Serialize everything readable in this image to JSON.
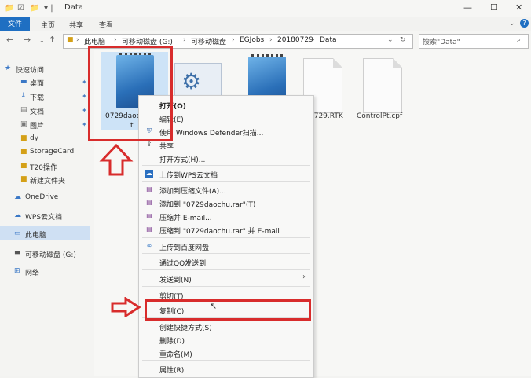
{
  "window": {
    "title": "Data",
    "quick_access": "▾ | ",
    "minimize": "—",
    "maximize": "☐",
    "close": "✕",
    "help": "?"
  },
  "ribbon": {
    "tabs": [
      "文件",
      "主页",
      "共享",
      "查看"
    ]
  },
  "address": {
    "crumbs": [
      "此电脑",
      "可移动磁盘 (G:)",
      "可移动磁盘",
      "EGJobs",
      "20180729",
      "Data"
    ],
    "search_placeholder": "搜索\"Data\""
  },
  "navpane": {
    "items": [
      {
        "label": "快速访问"
      },
      {
        "label": "桌面"
      },
      {
        "label": "下载"
      },
      {
        "label": "文档"
      },
      {
        "label": "图片"
      },
      {
        "label": "dy"
      },
      {
        "label": "StorageCard"
      },
      {
        "label": "T20操作"
      },
      {
        "label": "新建文件夹"
      },
      {
        "label": "OneDrive"
      },
      {
        "label": "WPS云文档"
      },
      {
        "label": "此电脑"
      },
      {
        "label": "可移动磁盘 (G:)"
      },
      {
        "label": "网络"
      }
    ]
  },
  "files": [
    {
      "name_line1": "0729daoc",
      "name_line2": "t",
      "icon": "notebook-icon"
    },
    {
      "name": "",
      "icon": "settings-file-icon"
    },
    {
      "name": "",
      "icon": "notebook-icon"
    },
    {
      "name": "0729.RTK",
      "icon": "document-icon"
    },
    {
      "name": "ControlPt.cpf",
      "icon": "document-icon"
    }
  ],
  "context_menu": {
    "items": [
      {
        "label": "打开(O)",
        "bold": true
      },
      {
        "label": "编辑(E)"
      },
      {
        "label": "使用 Windows Defender扫描..."
      },
      {
        "label": "共享"
      },
      {
        "label": "打开方式(H)..."
      },
      {
        "label": "上传到WPS云文档"
      },
      {
        "label": "添加到压缩文件(A)..."
      },
      {
        "label": "添加到 \"0729daochu.rar\"(T)"
      },
      {
        "label": "压缩并 E-mail..."
      },
      {
        "label": "压缩到 \"0729daochu.rar\" 并 E-mail"
      },
      {
        "label": "上传到百度网盘"
      },
      {
        "label": "通过QQ发送到"
      },
      {
        "label": "发送到(N)"
      },
      {
        "label": "剪切(T)"
      },
      {
        "label": "复制(C)"
      },
      {
        "label": "创建快捷方式(S)"
      },
      {
        "label": "删除(D)"
      },
      {
        "label": "重命名(M)"
      },
      {
        "label": "属性(R)"
      }
    ]
  },
  "colors": {
    "accent": "#1f6fc2",
    "annotation": "#d82c2c"
  }
}
